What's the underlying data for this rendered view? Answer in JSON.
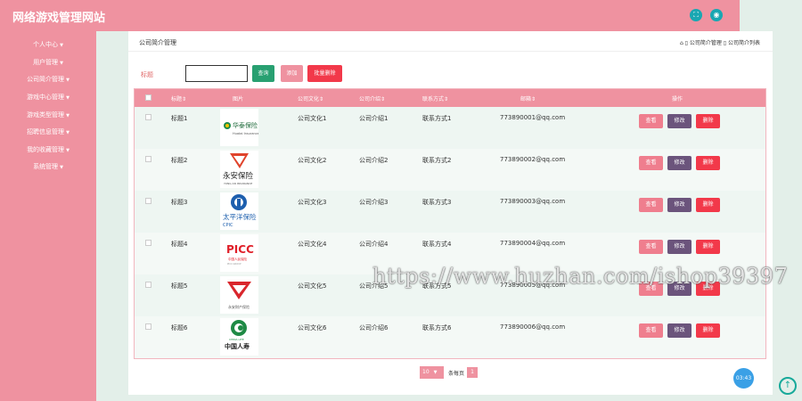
{
  "app": {
    "title": "网络游戏管理网站"
  },
  "colors": {
    "primary": "#ef92a0",
    "teal": "#28a071",
    "edit": "#6b547c",
    "delete": "#f2394a"
  },
  "topbar": {
    "icons": [
      "fullscreen-icon",
      "user-icon"
    ]
  },
  "sidebar": {
    "items": [
      {
        "label": "个人中心"
      },
      {
        "label": "用户管理"
      },
      {
        "label": "公司简介管理"
      },
      {
        "label": "游戏中心管理"
      },
      {
        "label": "游戏类型管理"
      },
      {
        "label": "招聘信息管理"
      },
      {
        "label": "我的收藏管理"
      },
      {
        "label": "系统管理"
      }
    ]
  },
  "page": {
    "title": "公司简介管理",
    "breadcrumb": "⌂ ▯ 公司简介管理 ▯ 公司简介列表"
  },
  "search": {
    "label": "标题",
    "value": "",
    "query_label": "查询",
    "add_label": "添加",
    "batch_delete_label": "批量删除"
  },
  "table": {
    "headers": [
      "标题⇕",
      "图片",
      "公司文化⇕",
      "公司介绍⇕",
      "联系方式⇕",
      "邮箱⇕",
      "操作"
    ],
    "rows": [
      {
        "title": "标题1",
        "culture": "公司文化1",
        "intro": "公司介绍1",
        "contact": "联系方式1",
        "email": "773890001@qq.com",
        "logo": "华泰保险 Huatai Insurance"
      },
      {
        "title": "标题2",
        "culture": "公司文化2",
        "intro": "公司介绍2",
        "contact": "联系方式2",
        "email": "773890002@qq.com",
        "logo": "永安保险 YONG AN INSURANCE"
      },
      {
        "title": "标题3",
        "culture": "公司文化3",
        "intro": "公司介绍3",
        "contact": "联系方式3",
        "email": "773890003@qq.com",
        "logo": "太平洋保险 CPIC"
      },
      {
        "title": "标题4",
        "culture": "公司文化4",
        "intro": "公司介绍4",
        "contact": "联系方式4",
        "email": "773890004@qq.com",
        "logo": "PICC 中国人民保险"
      },
      {
        "title": "标题5",
        "culture": "公司文化5",
        "intro": "公司介绍5",
        "contact": "联系方式5",
        "email": "773890005@qq.com",
        "logo": "永安财产保险"
      },
      {
        "title": "标题6",
        "culture": "公司文化6",
        "intro": "公司介绍6",
        "contact": "联系方式6",
        "email": "773890006@qq.com",
        "logo": "CHINA LIFE 中国人寿"
      }
    ],
    "actions": {
      "view": "查看",
      "edit": "修改",
      "delete": "删除"
    }
  },
  "pagination": {
    "page_size": "10",
    "per_page_label": "条每页",
    "current_page": "1"
  },
  "timer": "03:43",
  "watermark": "https://www.huzhan.com/ishop39397"
}
